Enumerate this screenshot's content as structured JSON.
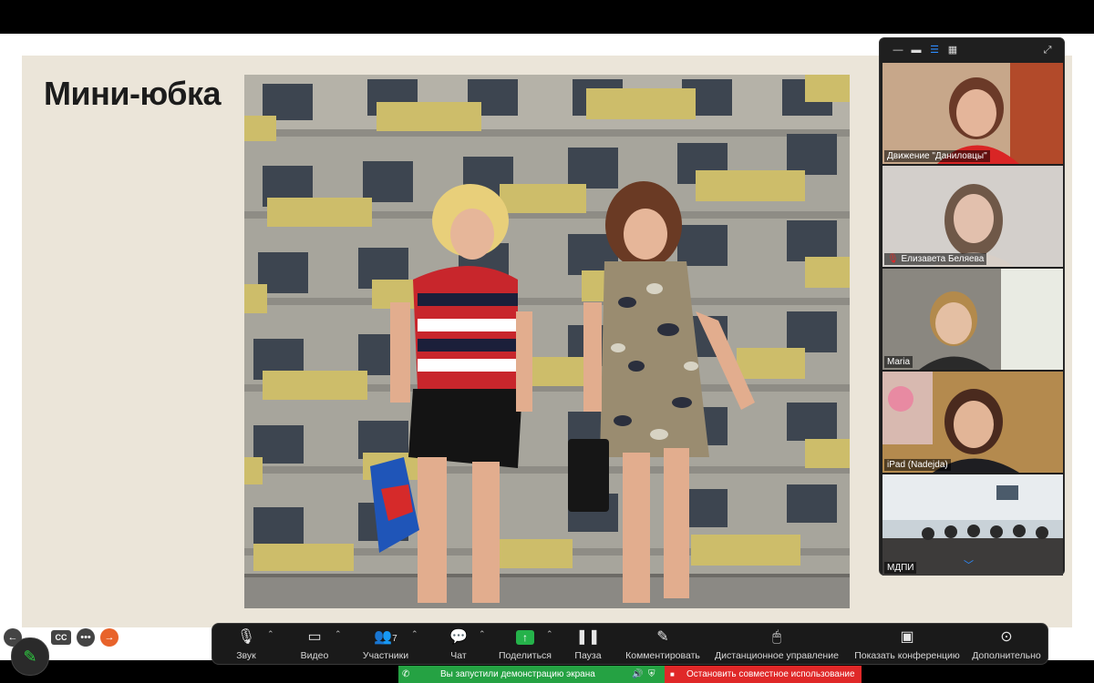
{
  "slide": {
    "title": "Мини-юбка"
  },
  "participants": [
    {
      "name": "Движение \"Даниловцы\"",
      "muted": false
    },
    {
      "name": "Елизавета Беляева",
      "muted": true
    },
    {
      "name": "Maria",
      "muted": false
    },
    {
      "name": "iPad (Nadejda)",
      "muted": false
    },
    {
      "name": "МДПИ",
      "muted": false
    }
  ],
  "panel_icons": [
    "minimize-icon",
    "thumbnail-icon",
    "speaker-view-icon",
    "gallery-icon",
    "fullscreen-icon"
  ],
  "float_controls": {
    "cc_label": "CC",
    "more_glyph": "•••"
  },
  "toolbar": {
    "items": [
      {
        "icon": "microphone-icon",
        "label": "Звук",
        "has_caret": true
      },
      {
        "icon": "camera-icon",
        "label": "Видео",
        "has_caret": true
      },
      {
        "icon": "participants-icon",
        "label": "Участники",
        "count": "7",
        "has_caret": true
      },
      {
        "icon": "chat-icon",
        "label": "Чат",
        "has_caret": true
      },
      {
        "icon": "share-icon",
        "label": "Поделиться",
        "has_caret": true
      },
      {
        "icon": "pause-icon",
        "label": "Пауза",
        "has_caret": false
      },
      {
        "icon": "annotate-icon",
        "label": "Комментировать",
        "has_caret": false
      },
      {
        "icon": "remote-control-icon",
        "label": "Дистанционное управление",
        "has_caret": false
      },
      {
        "icon": "show-meeting-icon",
        "label": "Показать конференцию",
        "has_caret": false
      },
      {
        "icon": "more-icon",
        "label": "Дополнительно",
        "has_caret": false
      }
    ]
  },
  "share_status": {
    "message": "Вы запустили демонстрацию экрана",
    "stop_label": "Остановить совместное использование"
  },
  "colors": {
    "slide_bg": "#ebe5d9",
    "share_green": "#25a243",
    "stop_red": "#e02828",
    "active_speaker": "#2ecc40"
  }
}
